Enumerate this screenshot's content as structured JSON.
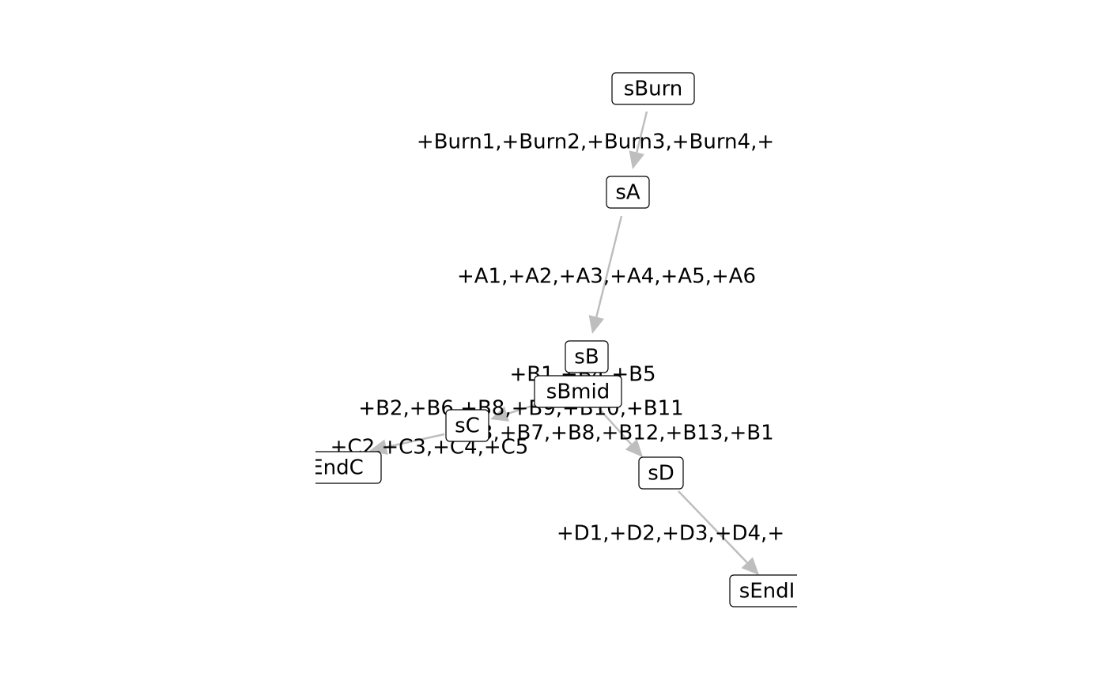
{
  "colors": {
    "edge": "#bebebe",
    "node_border": "#000000",
    "node_fill": "#ffffff",
    "text": "#000000",
    "background": "#ffffff"
  },
  "diagram": {
    "nodes": [
      {
        "id": "sBurn",
        "label": "sBurn"
      },
      {
        "id": "sA",
        "label": "sA"
      },
      {
        "id": "sB",
        "label": "sB"
      },
      {
        "id": "sBmid",
        "label": "sBmid"
      },
      {
        "id": "sC",
        "label": "sC"
      },
      {
        "id": "sEndC",
        "label": "EndC"
      },
      {
        "id": "sD",
        "label": "sD"
      },
      {
        "id": "sEndD",
        "label": "sEndI"
      }
    ],
    "edges": [
      {
        "id": "e-burn-a",
        "from": "sBurn",
        "to": "sA",
        "label": "+Burn1,+Burn2,+Burn3,+Burn4,+"
      },
      {
        "id": "e-a-b",
        "from": "sA",
        "to": "sB",
        "label": "+A1,+A2,+A3,+A4,+A5,+A6"
      },
      {
        "id": "e-b-bmid",
        "from": "sB",
        "to": "sBmid",
        "label": "+B1,+B4,+B5"
      },
      {
        "id": "e-bmid-c",
        "from": "sBmid",
        "to": "sC",
        "label": "+B2,+B6,+B8,+B9,+B10,+B11"
      },
      {
        "id": "e-bmid-d",
        "from": "sBmid",
        "to": "sD",
        "label": "+B3,+B7,+B8,+B12,+B13,+B1"
      },
      {
        "id": "e-c-endc",
        "from": "sC",
        "to": "sEndC",
        "label": "+C2,+C3,+C4,+C5"
      },
      {
        "id": "e-d-endd",
        "from": "sD",
        "to": "sEndD",
        "label": "+D1,+D2,+D3,+D4,+"
      }
    ]
  }
}
